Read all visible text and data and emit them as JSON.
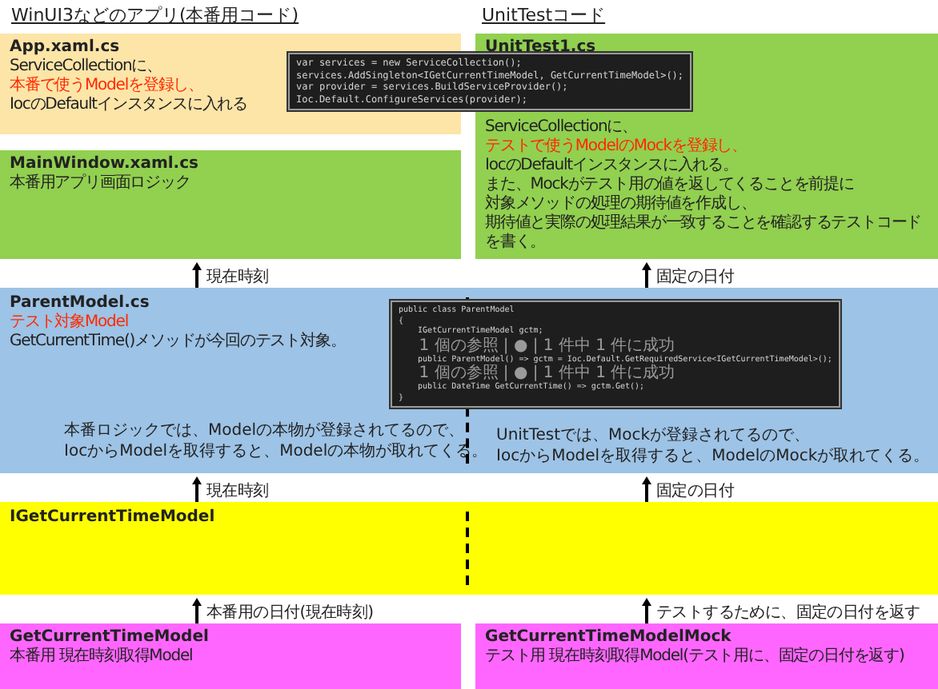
{
  "headings": [
    {
      "text": "WinUI3などのアプリ(本番用コード)"
    },
    {
      "text": "UnitTestコード"
    }
  ],
  "app_box": {
    "title": "App.xaml.cs",
    "lines": [
      {
        "text": "ServiceCollectionに、",
        "kind": "normal"
      },
      {
        "text": "本番で使うModelを登録し、",
        "kind": "emphasis"
      },
      {
        "text": "IocのDefaultインスタンスに入れる",
        "kind": "normal"
      }
    ]
  },
  "main_window_box": {
    "title": "MainWindow.xaml.cs",
    "lines": [
      {
        "text": "本番用アプリ画面ロジック",
        "kind": "normal"
      }
    ]
  },
  "unit_test_box": {
    "title": "UnitTest1.cs",
    "lines": [
      {
        "text": "ServiceCollectionに、",
        "kind": "normal"
      },
      {
        "text": "テストで使うModelのMockを登録し、",
        "kind": "emphasis"
      },
      {
        "text": "IocのDefaultインスタンスに入れる。",
        "kind": "normal"
      },
      {
        "text": "また、Mockがテスト用の値を返してくることを前提に",
        "kind": "normal"
      },
      {
        "text": "対象メソッドの処理の期待値を作成し、",
        "kind": "normal"
      },
      {
        "text": "期待値と実際の処理結果が一致することを確認するテストコードを書く。",
        "kind": "normal"
      }
    ]
  },
  "registration_code": {
    "lines": [
      {
        "text": "var services = new ServiceCollection();",
        "kind": "code"
      },
      {
        "text": "services.AddSingleton<IGetCurrentTimeModel, GetCurrentTimeModel>();",
        "kind": "code"
      },
      {
        "text": "var provider = services.BuildServiceProvider();",
        "kind": "code"
      },
      {
        "text": "Ioc.Default.ConfigureServices(provider);",
        "kind": "code"
      }
    ]
  },
  "arrows_to_parent": [
    {
      "label": "現在時刻"
    },
    {
      "label": "固定の日付"
    }
  ],
  "parent_model_box": {
    "title": "ParentModel.cs",
    "lines": [
      {
        "text": "テスト対象Model",
        "kind": "emphasis"
      },
      {
        "text": "GetCurrentTime()メソッドが今回のテスト対象。",
        "kind": "normal"
      }
    ],
    "notes": [
      {
        "lines": [
          "本番ロジックでは、Modelの本物が登録されてるので、",
          "IocからModelを取得すると、Modelの本物が取れてくる。"
        ]
      },
      {
        "lines": [
          "UnitTestでは、Mockが登録されてるので、",
          "IocからModelを取得すると、ModelのMockが取れてくる。"
        ]
      }
    ]
  },
  "parent_model_code": {
    "lines": [
      {
        "text": "public class ParentModel",
        "kind": "code"
      },
      {
        "text": "{",
        "kind": "code"
      },
      {
        "text": "    IGetCurrentTimeModel gctm;",
        "kind": "code"
      },
      {
        "text": "    1 個の参照 | ● | 1 件中 1 件に成功",
        "kind": "codelens"
      },
      {
        "text": "    public ParentModel() => gctm = Ioc.Default.GetRequiredService<IGetCurrentTimeModel>();",
        "kind": "code"
      },
      {
        "text": "    1 個の参照 | ● | 1 件中 1 件に成功",
        "kind": "codelens"
      },
      {
        "text": "    public DateTime GetCurrentTime() => gctm.Get();",
        "kind": "code"
      },
      {
        "text": "}",
        "kind": "code"
      }
    ]
  },
  "arrows_to_interface": [
    {
      "label": "現在時刻"
    },
    {
      "label": "固定の日付"
    }
  ],
  "interface_box": {
    "title": "IGetCurrentTimeModel"
  },
  "arrows_from_models": [
    {
      "label": "本番用の日付(現在時刻)"
    },
    {
      "label": "テストするために、固定の日付を返す"
    }
  ],
  "model_boxes": [
    {
      "title": "GetCurrentTimeModel",
      "lines": [
        {
          "text": "本番用 現在時刻取得Model",
          "kind": "normal"
        }
      ]
    },
    {
      "title": "GetCurrentTimeModelMock",
      "lines": [
        {
          "text": "テスト用 現在時刻取得Model(テスト用に、固定の日付を返す)",
          "kind": "normal"
        }
      ]
    }
  ]
}
